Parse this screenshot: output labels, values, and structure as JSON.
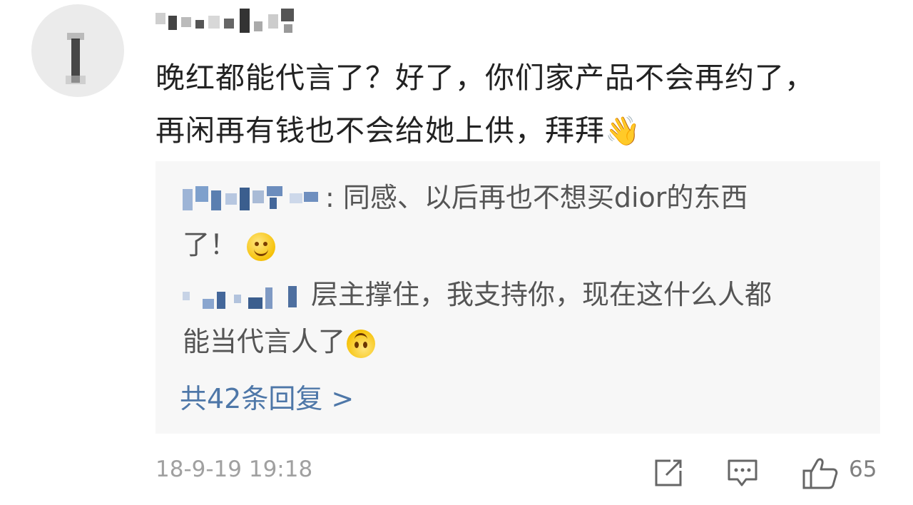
{
  "comment": {
    "text_line1": "晚红都能代言了？好了，你们家产品不会再约了，",
    "text_line2": "再闲再有钱也不会给她上供，拜拜",
    "emoji": "👋"
  },
  "replies": [
    {
      "text_line1": ": 同感、以后再也不想买dior的东西",
      "text_line2": "了！"
    },
    {
      "text_line1": "层主撑住，我支持你，现在这什么人都",
      "text_line2": "能当代言人了"
    }
  ],
  "more_replies_label": "共42条回复 >",
  "footer": {
    "timestamp": "18-9-19 19:18",
    "like_count": "65"
  },
  "icons": [
    "share-icon",
    "comment-icon",
    "like-icon"
  ],
  "colors": {
    "link": "#4e77a8",
    "reply_bg": "#f7f7f7",
    "muted": "#a0a0a0"
  }
}
